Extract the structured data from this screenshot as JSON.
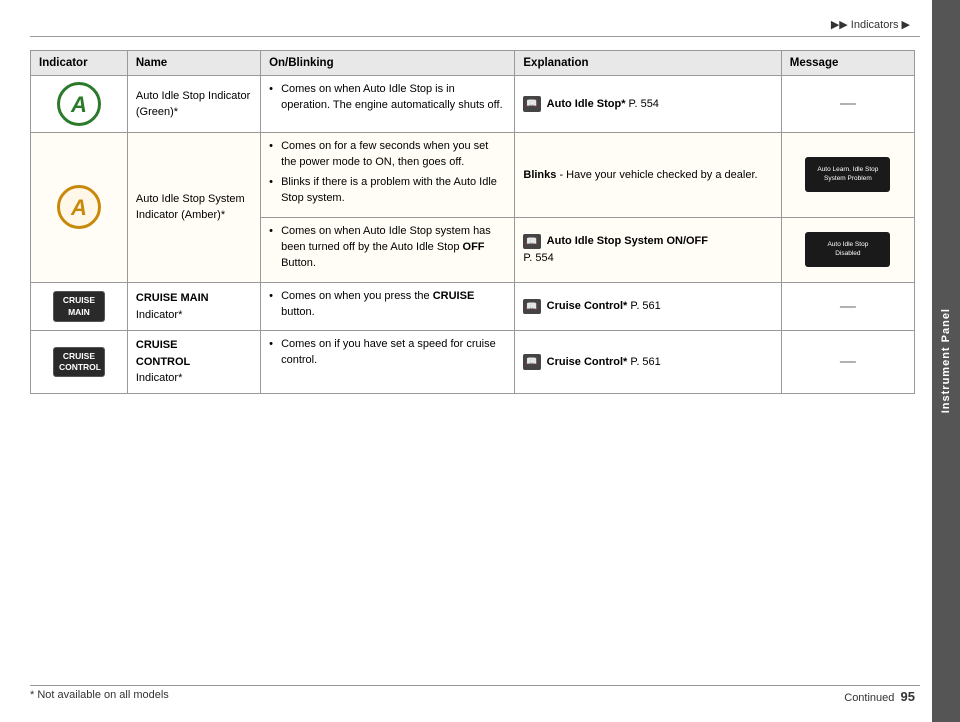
{
  "header": {
    "breadcrumb": "▶▶ Indicators ▶",
    "side_tab": "Instrument Panel"
  },
  "footer": {
    "footnote": "* Not available on all models",
    "continued": "Continued",
    "page_number": "95"
  },
  "table": {
    "headers": [
      "Indicator",
      "Name",
      "On/Blinking",
      "Explanation",
      "Message"
    ],
    "rows": [
      {
        "indicator_type": "circle-a-green",
        "name_line1": "Auto Idle Stop",
        "name_line2": "Indicator",
        "name_line3": "(Green)*",
        "on_blinking": [
          "Comes on when Auto Idle Stop is in operation. The engine automatically shuts off."
        ],
        "explanation_ref": "Auto Idle Stop*",
        "explanation_page": "P. 554",
        "message_type": "dash"
      },
      {
        "indicator_type": "circle-a-amber",
        "name_line1": "Auto Idle Stop",
        "name_line2": "System Indicator",
        "name_line3": "(Amber)*",
        "on_blinking": [
          "Comes on for a few seconds when you set the power mode to ON, then goes off.",
          "Blinks if there is a problem with the Auto Idle Stop system."
        ],
        "explanation_bullet": "Blinks",
        "explanation_text": " - Have your vehicle checked by a dealer.",
        "message_type": "image",
        "message_text1": "Auto Learn. Idle Stop",
        "message_text2": "System Problem"
      },
      {
        "indicator_type": "circle-a-amber-off",
        "name_line1": "Auto Idle Stop",
        "name_line2": "System Indicator",
        "name_line3": "(Amber)*",
        "on_blinking": [
          "Comes on when Auto Idle Stop system has been turned off by the Auto Idle Stop OFF Button."
        ],
        "explanation_ref": "Auto Idle Stop System ON/OFF",
        "explanation_page": "P. 554",
        "message_type": "image2",
        "message_text1": "Auto Idle Stop",
        "message_text2": "Disabled"
      },
      {
        "indicator_type": "cruise-main",
        "name_line1": "CRUISE MAIN",
        "name_line2": "Indicator*",
        "on_blinking": [
          "Comes on when you press the CRUISE button."
        ],
        "explanation_ref": "Cruise Control*",
        "explanation_page": "P. 561",
        "message_type": "dash"
      },
      {
        "indicator_type": "cruise-control",
        "name_line1": "CRUISE",
        "name_line2": "CONTROL",
        "name_line3": "Indicator*",
        "on_blinking": [
          "Comes on if you have set a speed for cruise control."
        ],
        "explanation_ref": "Cruise Control*",
        "explanation_page": "P. 561",
        "message_type": "dash"
      }
    ]
  }
}
